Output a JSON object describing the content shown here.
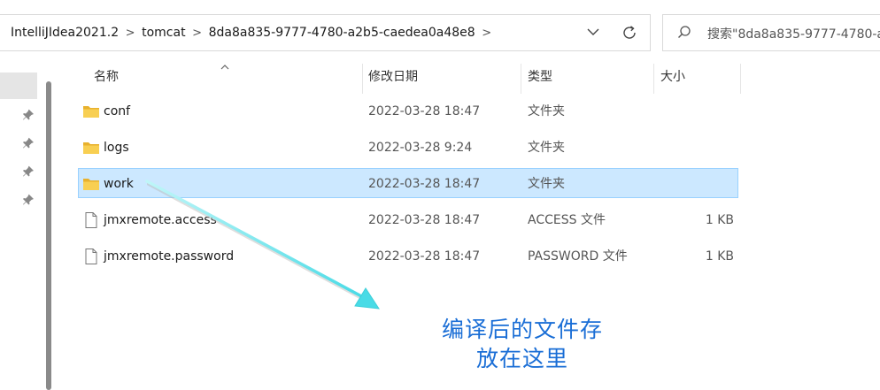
{
  "address": {
    "crumbs": [
      "IntelliJIdea2021.2",
      "tomcat",
      "8da8a835-9777-4780-a2b5-caedea0a48e8"
    ],
    "separator": ">"
  },
  "search": {
    "placeholder": "搜索\"8da8a835-9777-4780-a"
  },
  "columns": {
    "name": "名称",
    "date": "修改日期",
    "type": "类型",
    "size": "大小"
  },
  "files": [
    {
      "name": "conf",
      "date": "2022-03-28 18:47",
      "type": "文件夹",
      "size": "",
      "icon": "folder-icon",
      "selected": false
    },
    {
      "name": "logs",
      "date": "2022-03-28 9:24",
      "type": "文件夹",
      "size": "",
      "icon": "folder-icon",
      "selected": false
    },
    {
      "name": "work",
      "date": "2022-03-28 18:47",
      "type": "文件夹",
      "size": "",
      "icon": "folder-icon",
      "selected": true
    },
    {
      "name": "jmxremote.access",
      "date": "2022-03-28 18:47",
      "type": "ACCESS 文件",
      "size": "1 KB",
      "icon": "file-icon",
      "selected": false
    },
    {
      "name": "jmxremote.password",
      "date": "2022-03-28 18:47",
      "type": "PASSWORD 文件",
      "size": "1 KB",
      "icon": "file-icon",
      "selected": false
    }
  ],
  "annotation": {
    "line1": "编译后的文件存",
    "line2": "放在这里"
  },
  "colors": {
    "selection": "#cce8ff",
    "selection_border": "#99d1ff",
    "annotation_text": "#1a6ed6",
    "arrow": "#5ee0e8",
    "folder": "#f4c542"
  }
}
